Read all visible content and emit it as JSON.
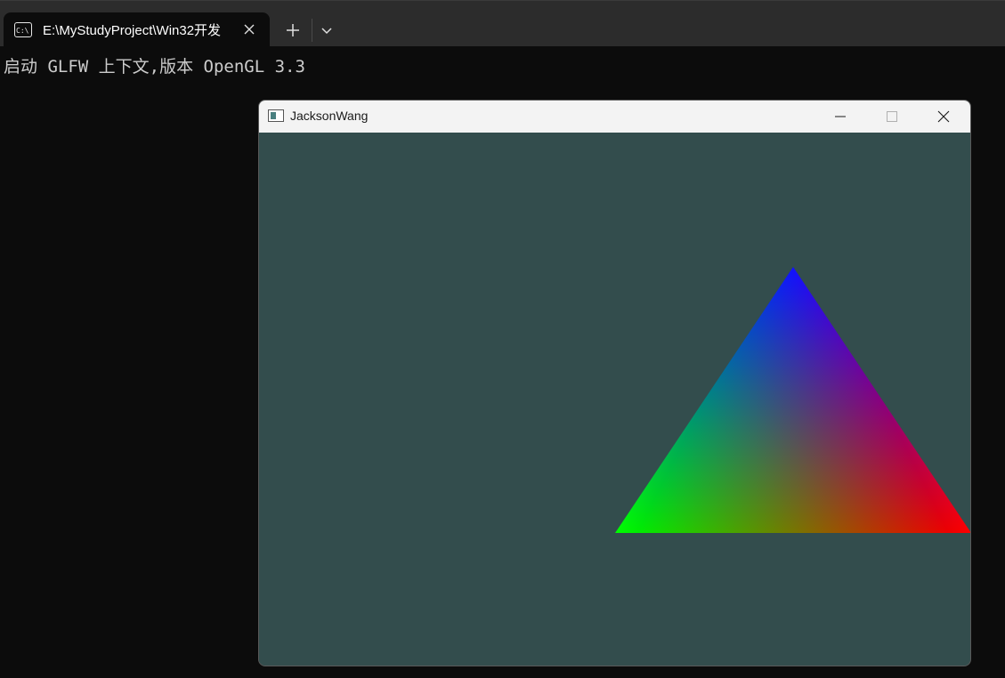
{
  "terminal": {
    "tab_title": "E:\\MyStudyProject\\Win32开发",
    "tab_icon": "terminal-icon",
    "output_line": "启动 GLFW 上下文,版本 OpenGL 3.3",
    "background_color": "#0c0c0c"
  },
  "glfw_window": {
    "title": "JacksonWang",
    "clear_color": "#334d4d",
    "triangle_vertex_colors": {
      "top": "#0000ff",
      "bottom_left": "#00ff00",
      "bottom_right": "#ff0000"
    }
  }
}
